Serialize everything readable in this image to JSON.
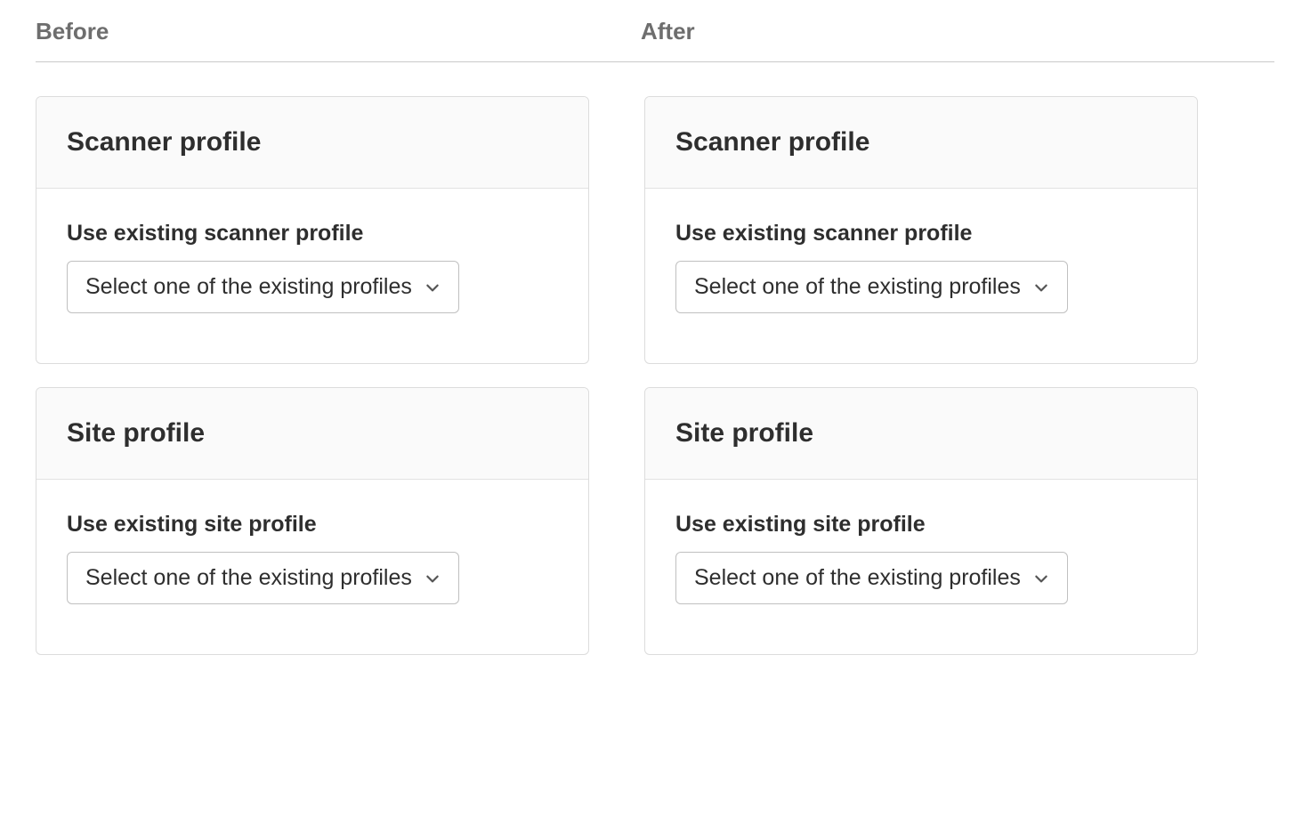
{
  "header": {
    "before_label": "Before",
    "after_label": "After"
  },
  "before": {
    "scanner": {
      "title": "Scanner profile",
      "field_label": "Use existing scanner profile",
      "dropdown_text": "Select one of the existing profiles"
    },
    "site": {
      "title": "Site profile",
      "field_label": "Use existing site profile",
      "dropdown_text": "Select one of the existing profiles"
    }
  },
  "after": {
    "scanner": {
      "title": "Scanner profile",
      "field_label": "Use existing scanner profile",
      "dropdown_text": "Select one of the existing profiles"
    },
    "site": {
      "title": "Site profile",
      "field_label": "Use existing site profile",
      "dropdown_text": "Select one of the existing profiles"
    }
  }
}
